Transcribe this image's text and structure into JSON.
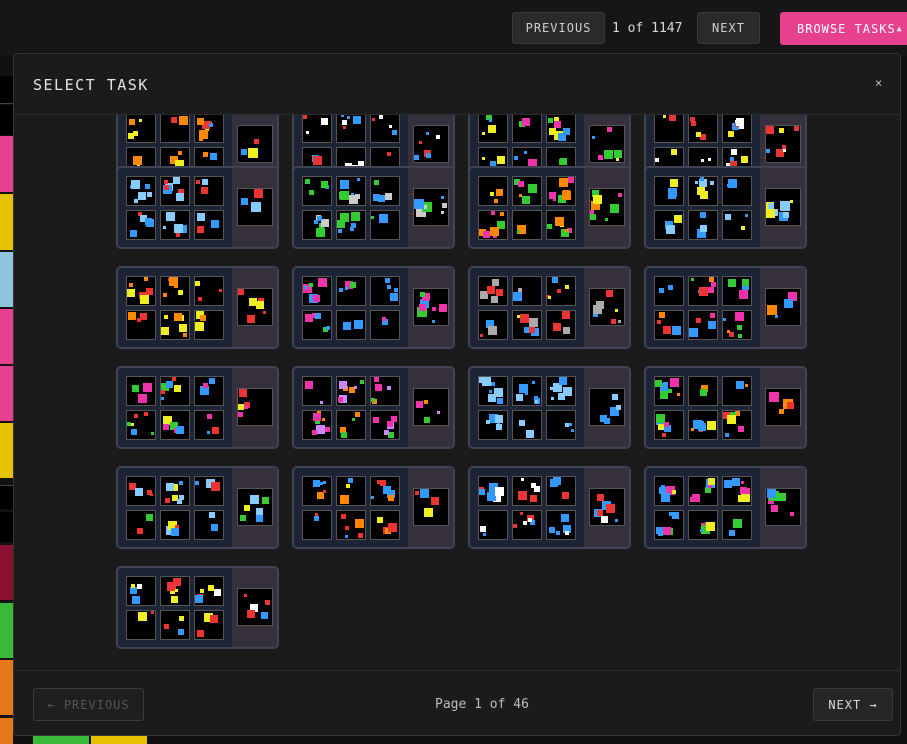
{
  "topbar": {
    "previous_label": "PREVIOUS",
    "counter": "1 of 1147",
    "next_label": "NEXT",
    "browse_label": "BROWSE TASKS",
    "browse_arrow": "▲"
  },
  "modal": {
    "title": "SELECT TASK",
    "close_label": "×"
  },
  "footer": {
    "previous_label": "← PREVIOUS",
    "page_info": "Page 1 of 46",
    "next_label": "NEXT →"
  },
  "colors": {
    "accent": "#e6408f",
    "card_border": "#3e4454",
    "card_bg": "#1e2534",
    "card_side": "#362f3c"
  }
}
